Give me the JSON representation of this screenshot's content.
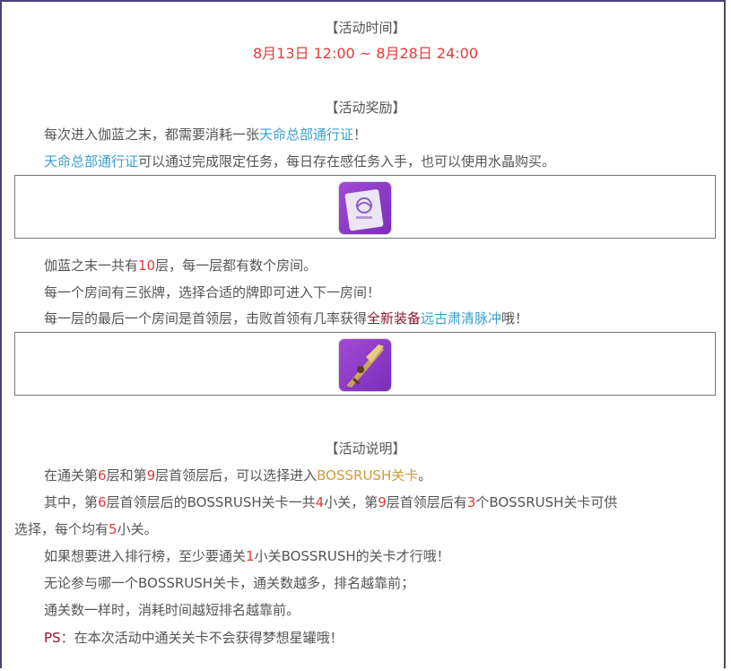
{
  "time_section": {
    "heading": "【活动时间】",
    "range": "8月13日 12:00 ~ 8月28日 24:00"
  },
  "reward_section": {
    "heading": "【活动奖励】",
    "line1_a": "每次进入伽蓝之末，都需要消耗一张",
    "line1_b": "天命总部通行证",
    "line1_c": "！",
    "line2_a": "天命总部通行证",
    "line2_b": "可以通过完成限定任务，每日存在感任务入手，也可以使用水晶购买。",
    "item1_icon": "pass-ticket-icon",
    "floors_a": "伽蓝之末一共有",
    "floors_num": "10",
    "floors_b": "层，每一层都有数个房间。",
    "rooms": "每一个房间有三张牌，选择合适的牌即可进入下一房间！",
    "boss_a": "每一层的最后一个房间是首领层，击败首领有几率获得",
    "boss_b": "全新装备",
    "boss_c": "远古肃清脉冲",
    "boss_d": "哦！",
    "item2_icon": "weapon-icon"
  },
  "desc_section": {
    "heading": "【活动说明】",
    "p1_a": "在通关第",
    "p1_n1": "6",
    "p1_b": "层和第",
    "p1_n2": "9",
    "p1_c": "层首领层后，可以选择进入",
    "p1_d": "BOSSRUSH关卡",
    "p1_e": "。",
    "p2_a": "其中，第",
    "p2_n1": "6",
    "p2_b": "层首领层后的BOSSRUSH关卡一共",
    "p2_n2": "4",
    "p2_c": "小关，第",
    "p2_n3": "9",
    "p2_d": "层首领层后有",
    "p2_n4": "3",
    "p2_e": "个BOSSRUSH关卡可供",
    "p2_f": "选择，每个均有",
    "p2_n5": "5",
    "p2_g": "小关。",
    "p3_a": "如果想要进入排行榜，至少要通关",
    "p3_n": "1",
    "p3_b": "小关BOSSRUSH的关卡才行哦！",
    "p4": "无论参与哪一个BOSSRUSH关卡，通关数越多，排名越靠前；",
    "p5": "通关数一样时，消耗时间越短排名越靠前。",
    "ps_label": "PS",
    "ps_text": "：在本次活动中通关关卡不会获得梦想星罐哦！"
  },
  "colors": {
    "frame": "#4a4274",
    "red": "#e53a3a",
    "blue": "#3aa0cf",
    "gold": "#d29a3c",
    "maroon": "#8b1a33",
    "text": "#555555"
  }
}
